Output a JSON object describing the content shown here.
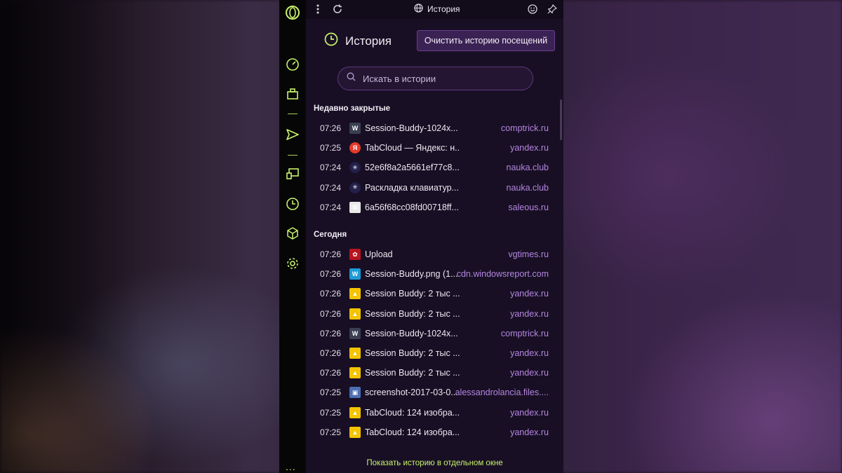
{
  "topbar": {
    "menu_icon": "kebab-menu-icon",
    "reload_icon": "reload-icon",
    "title": "История",
    "title_icon": "globe-icon",
    "emoji_icon": "smiley-icon",
    "pin_icon": "pin-icon"
  },
  "sidebar": {
    "items": [
      {
        "name": "opera-logo-icon"
      },
      {
        "name": "speed-dial-icon"
      },
      {
        "name": "workspace-icon"
      },
      {
        "name": "send-icon"
      },
      {
        "name": "tabs-devices-icon"
      },
      {
        "name": "history-icon"
      },
      {
        "name": "extensions-cube-icon"
      },
      {
        "name": "settings-gear-icon"
      }
    ],
    "more": "..."
  },
  "header": {
    "title": "История",
    "clear_button": "Очистить историю посещений"
  },
  "search": {
    "placeholder": "Искать в истории"
  },
  "sections": {
    "recent_title": "Недавно закрытые",
    "today_title": "Сегодня"
  },
  "recent": [
    {
      "time": "07:26",
      "title": "Session-Buddy-1024x...",
      "domain": "comptrick.ru",
      "icon": "wordpress-icon"
    },
    {
      "time": "07:25",
      "title": "TabCloud — Яндекс: н...",
      "domain": "yandex.ru",
      "icon": "yandex-icon"
    },
    {
      "time": "07:24",
      "title": "52e6f8a2a5661ef77c8...",
      "domain": "nauka.club",
      "icon": "atom-icon"
    },
    {
      "time": "07:24",
      "title": "Раскладка клавиатур...",
      "domain": "nauka.club",
      "icon": "atom-icon"
    },
    {
      "time": "07:24",
      "title": "6a56f68cc08fd00718ff...",
      "domain": "saleous.ru",
      "icon": "saleous-icon"
    }
  ],
  "today": [
    {
      "time": "07:26",
      "title": "Upload",
      "domain": "vgtimes.ru",
      "icon": "vgtimes-icon"
    },
    {
      "time": "07:26",
      "title": "Session-Buddy.png (1...",
      "domain": "cdn.windowsreport.com",
      "icon": "windowsreport-icon"
    },
    {
      "time": "07:26",
      "title": "Session Buddy: 2 тыс ...",
      "domain": "yandex.ru",
      "icon": "yandex-images-icon"
    },
    {
      "time": "07:26",
      "title": "Session Buddy: 2 тыс ...",
      "domain": "yandex.ru",
      "icon": "yandex-images-icon"
    },
    {
      "time": "07:26",
      "title": "Session-Buddy-1024x...",
      "domain": "comptrick.ru",
      "icon": "wordpress-icon"
    },
    {
      "time": "07:26",
      "title": "Session Buddy: 2 тыс ...",
      "domain": "yandex.ru",
      "icon": "yandex-images-icon"
    },
    {
      "time": "07:26",
      "title": "Session Buddy: 2 тыс ...",
      "domain": "yandex.ru",
      "icon": "yandex-images-icon"
    },
    {
      "time": "07:25",
      "title": "screenshot-2017-03-0...",
      "domain": "alessandrolancia.files....",
      "icon": "avatar-thumbnail-icon"
    },
    {
      "time": "07:25",
      "title": "TabCloud: 124 изобра...",
      "domain": "yandex.ru",
      "icon": "yandex-images-icon"
    },
    {
      "time": "07:25",
      "title": "TabCloud: 124 изобра...",
      "domain": "yandex.ru",
      "icon": "yandex-images-icon"
    }
  ],
  "footer": {
    "link": "Показать историю в отдельном окне"
  },
  "colors": {
    "accent": "#c8f26a",
    "domain": "#b486e0",
    "panel_bg": "#180f24",
    "button_bg": "#3b2254"
  }
}
